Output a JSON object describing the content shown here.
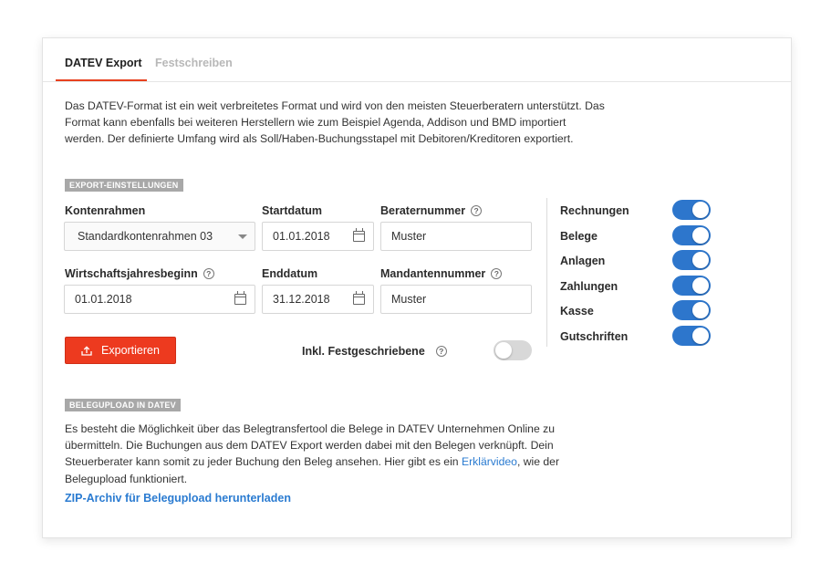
{
  "tabs": [
    {
      "label": "DATEV Export",
      "active": true
    },
    {
      "label": "Festschreiben",
      "active": false
    }
  ],
  "intro": {
    "line1": "Das DATEV-Format ist ein weit verbreitetes Format und wird von den meisten Steuerberatern unterstützt. Das",
    "line2": "Format kann ebenfalls bei weiteren Herstellern wie zum Beispiel Agenda, Addison und BMD importiert",
    "line3": "werden. Der definierte Umfang wird als Soll/Haben-Buchungsstapel mit Debitoren/Kreditoren exportiert."
  },
  "export_settings": {
    "section_label": "EXPORT-EINSTELLUNGEN",
    "kontenrahmen": {
      "label": "Kontenrahmen",
      "value": "Standardkontenrahmen 03"
    },
    "startdatum": {
      "label": "Startdatum",
      "value": "01.01.2018"
    },
    "beraternummer": {
      "label": "Beraternummer",
      "value": "Muster"
    },
    "wirtschaftsjahresbeginn": {
      "label": "Wirtschaftsjahresbeginn",
      "value": "01.01.2018"
    },
    "enddatum": {
      "label": "Enddatum",
      "value": "31.12.2018"
    },
    "mandantennummer": {
      "label": "Mandantennummer",
      "value": "Muster"
    },
    "export_button": "Exportieren",
    "inkl_festgeschriebene": {
      "label": "Inkl. Festgeschriebene",
      "on": false
    }
  },
  "options": [
    {
      "label": "Rechnungen",
      "on": true
    },
    {
      "label": "Belege",
      "on": true
    },
    {
      "label": "Anlagen",
      "on": true
    },
    {
      "label": "Zahlungen",
      "on": true
    },
    {
      "label": "Kasse",
      "on": true
    },
    {
      "label": "Gutschriften",
      "on": true
    }
  ],
  "belegupload": {
    "section_label": "BELEGUPLOAD IN DATEV",
    "line1": "Es besteht die Möglichkeit über das Belegtransfertool die Belege in DATEV Unternehmen Online zu",
    "line2": "übermitteln. Die Buchungen aus dem DATEV Export werden dabei mit den Belegen verknüpft. Dein",
    "line3_pre": "Steuerberater kann somit zu jeder Buchung den Beleg ansehen. Hier gibt es ein ",
    "line3_link": "Erklärvideo",
    "line3_post": ", wie der",
    "line4": "Belegupload funktioniert.",
    "download_link": "ZIP-Archiv für Belegupload herunterladen"
  },
  "colors": {
    "accent_red": "#ed3a1f",
    "toggle_blue": "#2d76cc",
    "link_blue": "#2a7bd1"
  }
}
